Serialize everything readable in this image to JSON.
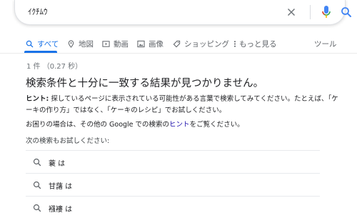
{
  "search": {
    "query": "ｲｸﾁﾑｳ"
  },
  "tabs": [
    {
      "label": "すべて",
      "icon": "search-icon"
    },
    {
      "label": "地図",
      "icon": "map-pin-icon"
    },
    {
      "label": "動画",
      "icon": "video-icon"
    },
    {
      "label": "画像",
      "icon": "image-icon"
    },
    {
      "label": "ショッピング",
      "icon": "tag-icon"
    },
    {
      "label": "もっと見る",
      "icon": "more-vert-icon"
    },
    {
      "label": "ツール"
    }
  ],
  "results": {
    "stats": "1 件 （0.27 秒）",
    "headline": "検索条件と十分に一致する結果が見つかりません。",
    "hint_label": "ヒント:",
    "hint_text": " 探しているページに表示されている可能性がある言葉で検索してみてください。たとえば、「ケーキの作り方」ではなく、「ケーキのレシピ」でお試しください。",
    "help_before": "お困りの場合は、その他の Google での検索の",
    "help_link": "ヒント",
    "help_after": "をご覧ください。",
    "try_label": "次の検索もお試しください:",
    "suggestions": [
      {
        "text": "蓑 は"
      },
      {
        "text": "甘藷 は"
      },
      {
        "text": "襁褸 は"
      }
    ]
  },
  "colors": {
    "accent": "#1a73e8",
    "link": "#1a0dab",
    "text": "#202124",
    "muted": "#70757a"
  }
}
